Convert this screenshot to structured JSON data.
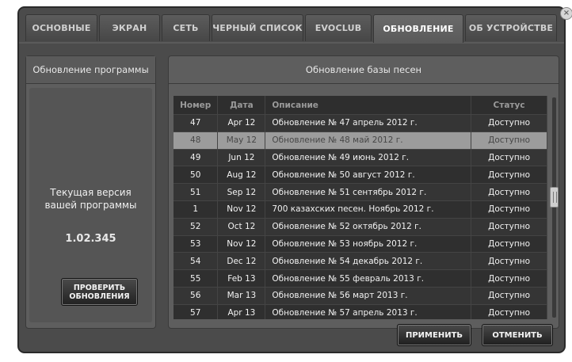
{
  "tabs": [
    {
      "label": "ОСНОВНЫЕ",
      "active": false
    },
    {
      "label": "ЭКРАН",
      "active": false
    },
    {
      "label": "СЕТЬ",
      "active": false
    },
    {
      "label": "ЧЕРНЫЙ СПИСОК",
      "active": false
    },
    {
      "label": "EVOCLUB",
      "active": false
    },
    {
      "label": "ОБНОВЛЕНИЕ",
      "active": true
    },
    {
      "label": "ОБ УСТРОЙСТВЕ",
      "active": false
    }
  ],
  "left_panel": {
    "title": "Обновление программы",
    "current_version_label_line1": "Текущая версия",
    "current_version_label_line2": "вашей программы",
    "current_version": "1.02.345",
    "check_button_line1": "ПРОВЕРИТЬ",
    "check_button_line2": "ОБНОВЛЕНИЯ"
  },
  "right_panel": {
    "title": "Обновление базы песен",
    "columns": [
      "Номер",
      "Дата",
      "Описание",
      "Статус"
    ],
    "selected_row": 1,
    "rows": [
      {
        "number": "47",
        "date": "Apr 12",
        "description": "Обновление № 47  апрель 2012 г.",
        "status": "Доступно"
      },
      {
        "number": "48",
        "date": "May 12",
        "description": "Обновление № 48  май 2012 г.",
        "status": "Доступно"
      },
      {
        "number": "49",
        "date": "Jun 12",
        "description": "Обновление № 49  июнь 2012 г.",
        "status": "Доступно"
      },
      {
        "number": "50",
        "date": "Aug 12",
        "description": "Обновление № 50  август 2012 г.",
        "status": "Доступно"
      },
      {
        "number": "51",
        "date": "Sep 12",
        "description": "Обновление № 51  сентябрь 2012 г.",
        "status": "Доступно"
      },
      {
        "number": "1",
        "date": "Nov 12",
        "description": "700 казахских песен.  Ноябрь 2012 г.",
        "status": "Доступно"
      },
      {
        "number": "52",
        "date": "Oct 12",
        "description": "Обновление № 52  октябрь 2012 г.",
        "status": "Доступно"
      },
      {
        "number": "53",
        "date": "Nov 12",
        "description": "Обновление № 53  ноябрь 2012 г.",
        "status": "Доступно"
      },
      {
        "number": "54",
        "date": "Dec 12",
        "description": "Обновление № 54  декабрь 2012 г.",
        "status": "Доступно"
      },
      {
        "number": "55",
        "date": "Feb 13",
        "description": "Обновление № 55  февраль 2013 г.",
        "status": "Доступно"
      },
      {
        "number": "56",
        "date": "Mar 13",
        "description": "Обновление № 56  март 2013 г.",
        "status": "Доступно"
      },
      {
        "number": "57",
        "date": "Apr 13",
        "description": "Обновление № 57  апрель 2013 г.",
        "status": "Доступно"
      }
    ]
  },
  "buttons": {
    "apply": "ПРИМЕНИТЬ",
    "cancel": "ОТМЕНИТЬ"
  },
  "icons": {
    "close": "close-icon",
    "scroll_thumb": "scroll-thumb"
  }
}
